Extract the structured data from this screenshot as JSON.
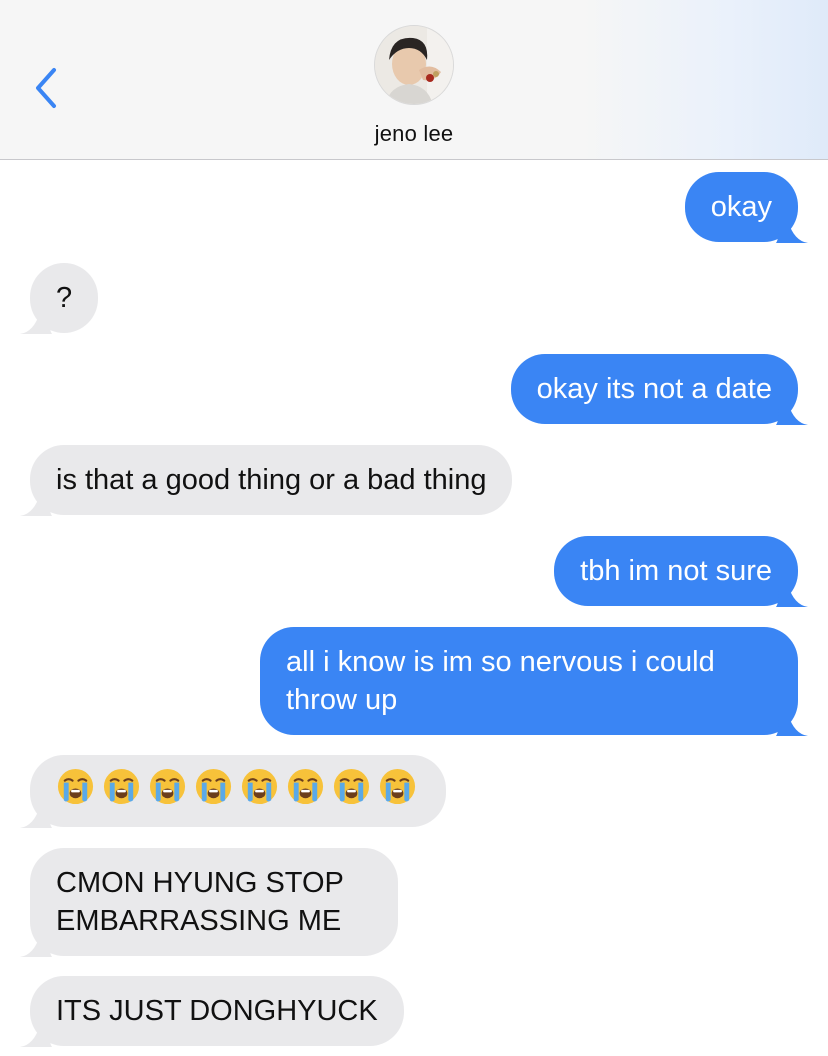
{
  "header": {
    "back_icon": "chevron-left-icon",
    "contact_name": "jeno lee",
    "avatar_icon": "contact-photo"
  },
  "messages": [
    {
      "side": "sent",
      "text": "okay"
    },
    {
      "side": "received",
      "text": "?"
    },
    {
      "side": "sent",
      "text": "okay its not a date"
    },
    {
      "side": "received",
      "text": "is that a good thing or a bad thing"
    },
    {
      "side": "sent",
      "text": "tbh im not sure"
    },
    {
      "side": "sent",
      "lines": [
        "all i know is im so nervous i could",
        "throw up"
      ]
    },
    {
      "side": "received",
      "emoji": "😭",
      "emoji_count": 8
    },
    {
      "side": "received",
      "lines": [
        "CMON HYUNG STOP",
        "EMBARRASSING ME"
      ]
    },
    {
      "side": "received",
      "text": "ITS JUST DONGHYUCK"
    }
  ],
  "colors": {
    "sent_bubble": "#3a85f4",
    "received_bubble": "#e9e9eb",
    "accent": "#3a85f4"
  }
}
